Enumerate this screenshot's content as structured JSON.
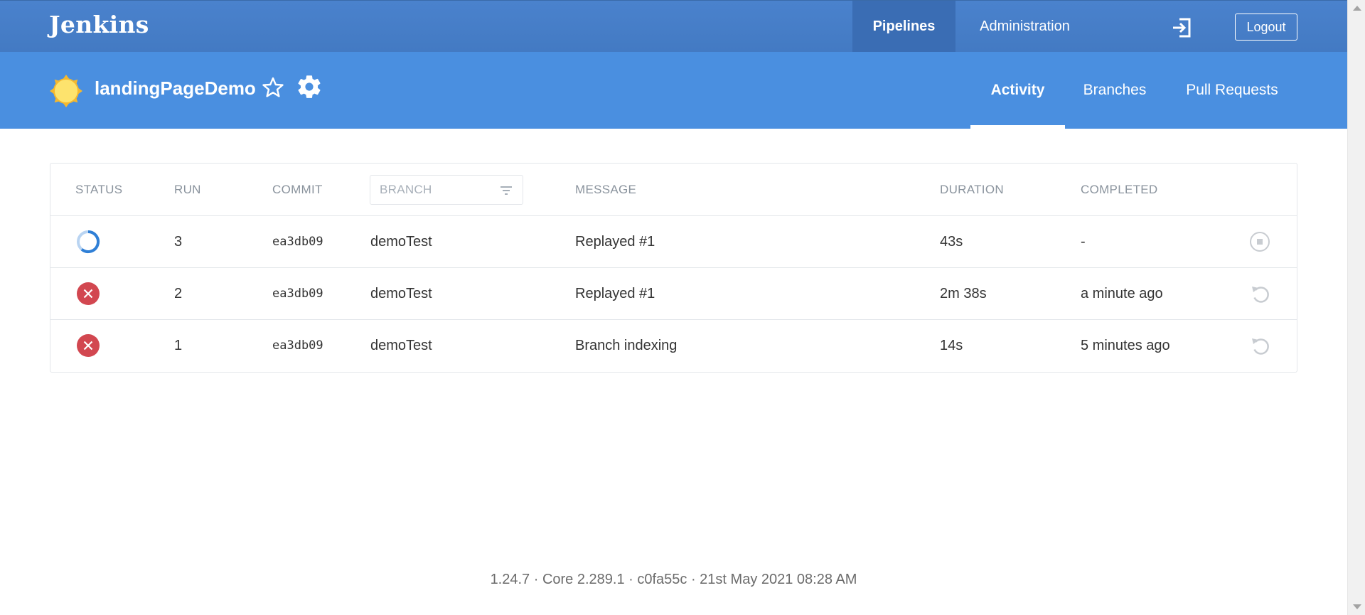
{
  "app": {
    "logo": "Jenkins",
    "nav": {
      "pipelines": "Pipelines",
      "administration": "Administration"
    },
    "logout": "Logout"
  },
  "pipeline": {
    "name": "landingPageDemo",
    "tabs": {
      "activity": "Activity",
      "branches": "Branches",
      "pull_requests": "Pull Requests"
    }
  },
  "table": {
    "headers": {
      "status": "STATUS",
      "run": "RUN",
      "commit": "COMMIT",
      "branch": "BRANCH",
      "message": "MESSAGE",
      "duration": "DURATION",
      "completed": "COMPLETED"
    },
    "rows": [
      {
        "status": "running",
        "run": "3",
        "commit": "ea3db09",
        "branch": "demoTest",
        "message": "Replayed #1",
        "duration": "43s",
        "completed": "-",
        "action": "stop-icon"
      },
      {
        "status": "failed",
        "run": "2",
        "commit": "ea3db09",
        "branch": "demoTest",
        "message": "Replayed #1",
        "duration": "2m 38s",
        "completed": "a minute ago",
        "action": "replay-icon"
      },
      {
        "status": "failed",
        "run": "1",
        "commit": "ea3db09",
        "branch": "demoTest",
        "message": "Branch indexing",
        "duration": "14s",
        "completed": "5 minutes ago",
        "action": "replay-icon"
      }
    ]
  },
  "footer": "1.24.7 · Core 2.289.1 · c0fa55c · 21st May 2021 08:28 AM",
  "colors": {
    "topbar": "#437ac3",
    "subbar": "#4a8fe0",
    "failed": "#d24750",
    "running": "#2f7fd6"
  }
}
